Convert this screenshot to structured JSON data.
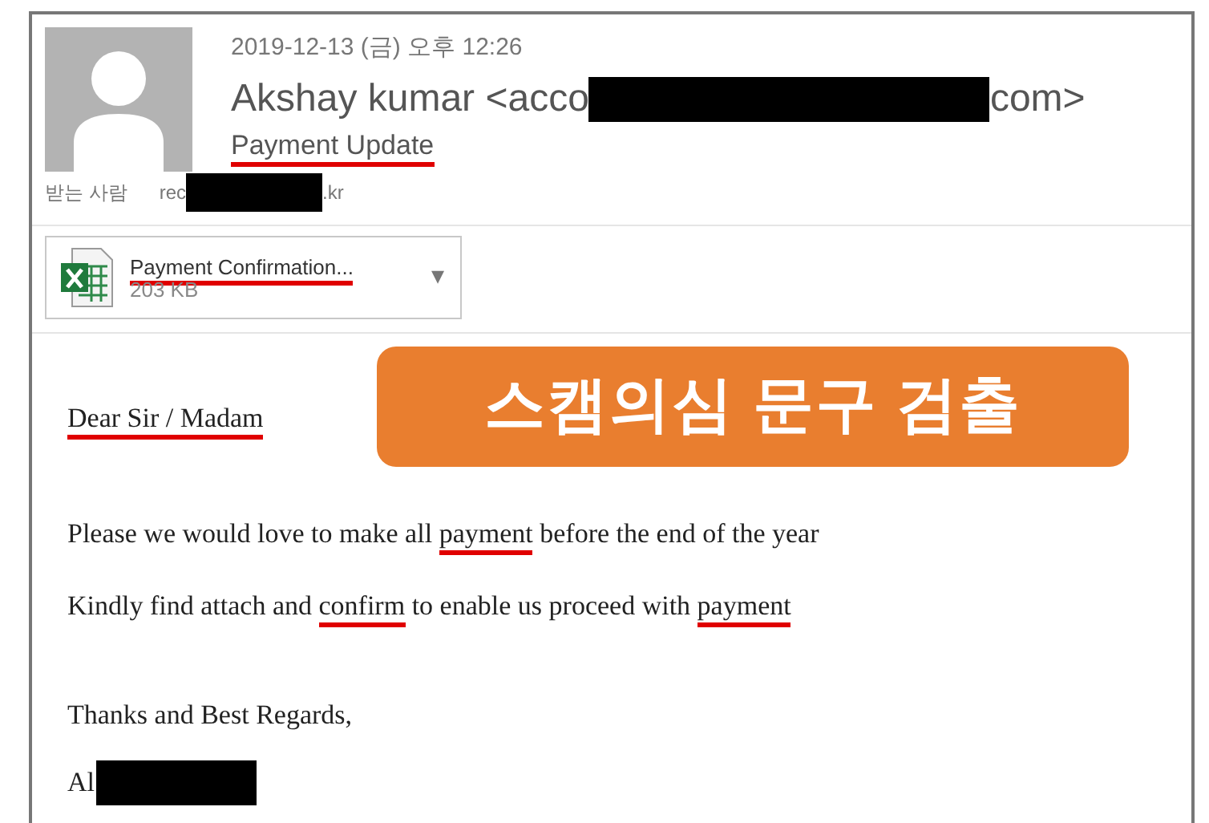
{
  "header": {
    "date": "2019-12-13 (금) 오후 12:26",
    "sender_start": "Akshay kumar <acco",
    "sender_end": "com>",
    "subject": {
      "text": "Payment Update",
      "flagged": true
    },
    "to_label": "받는 사람",
    "to_start": "rec",
    "to_end": ".kr"
  },
  "attachment": {
    "name": {
      "text": "Payment Confirmation...",
      "flagged": true
    },
    "size": "203 KB",
    "caret": "▾"
  },
  "banner": "스캠의심 문구 검출",
  "body": [
    {
      "segments": [
        {
          "text": "Dear Sir / Madam",
          "flagged": true
        }
      ]
    },
    {
      "segments": [
        {
          "text": "Please we would love to make all ",
          "flagged": false
        },
        {
          "text": "payment",
          "flagged": true
        },
        {
          "text": " before the end of the year",
          "flagged": false
        }
      ]
    },
    {
      "segments": [
        {
          "text": "Kindly find attach and ",
          "flagged": false
        },
        {
          "text": "confirm",
          "flagged": true
        },
        {
          "text": " to enable us proceed with ",
          "flagged": false
        },
        {
          "text": "payment",
          "flagged": true
        }
      ]
    },
    {
      "segments": [
        {
          "text": "Thanks and Best Regards,",
          "flagged": false
        }
      ]
    }
  ],
  "signature_start": "Al"
}
